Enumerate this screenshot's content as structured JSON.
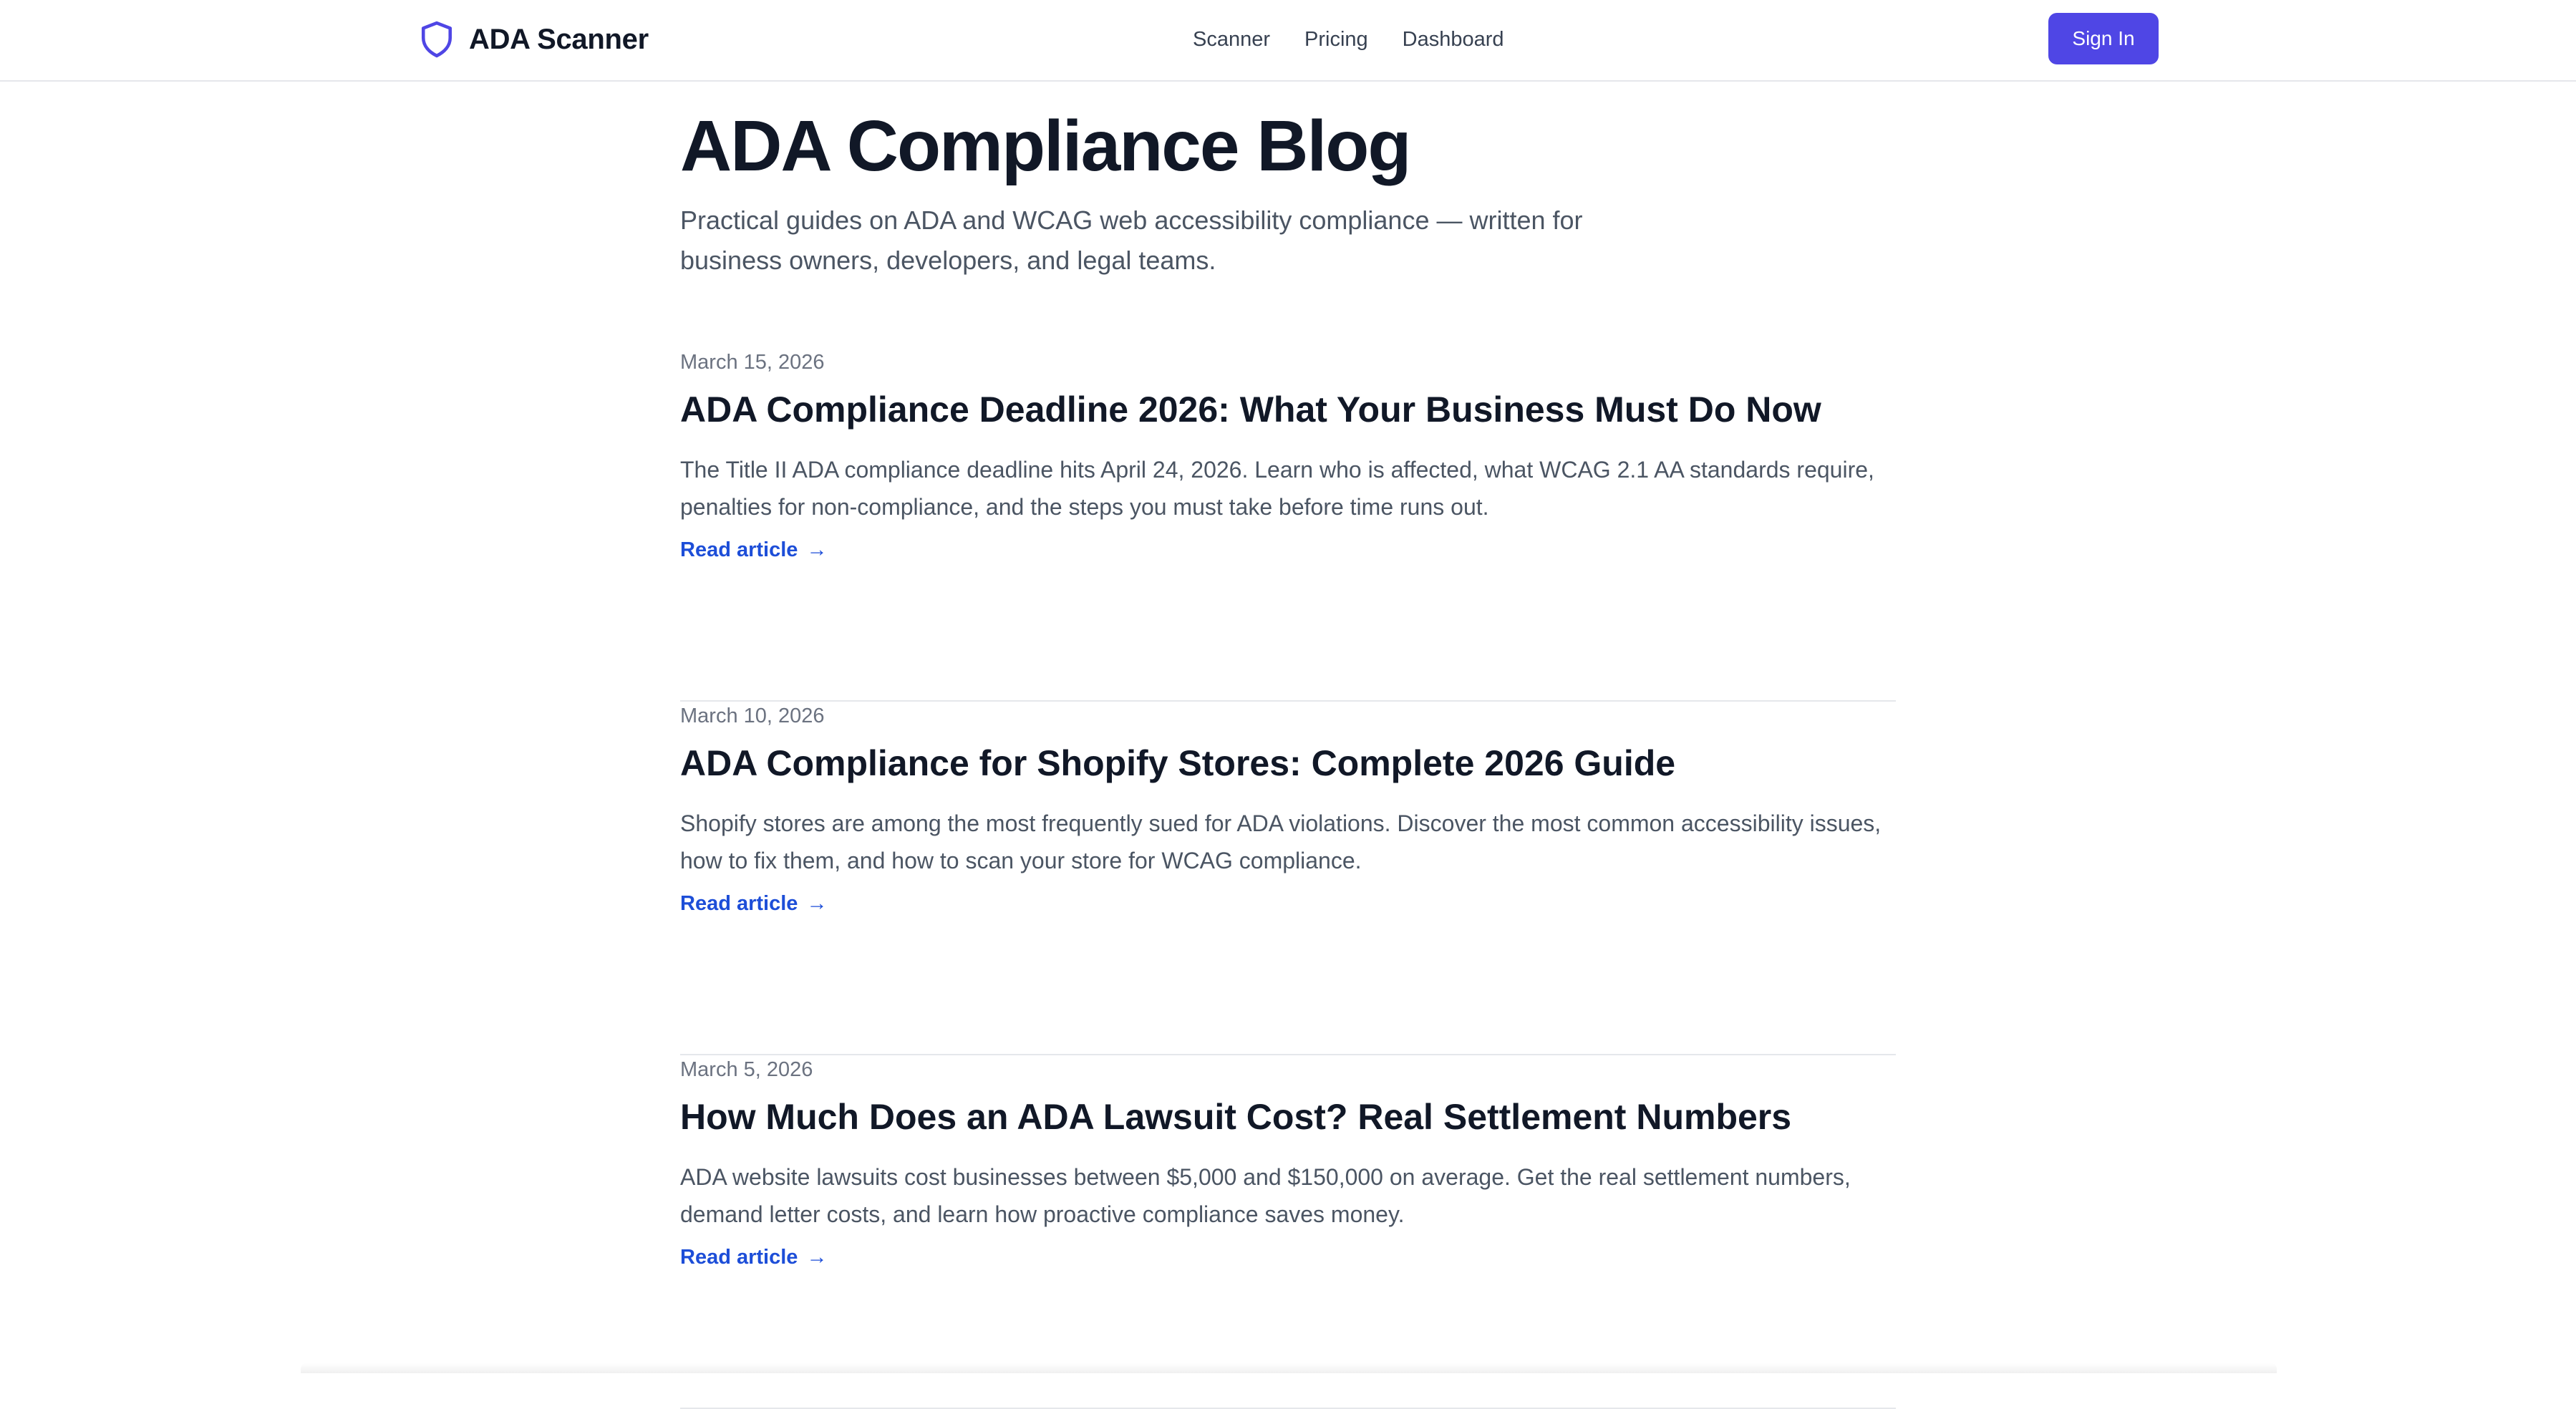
{
  "header": {
    "brand_name": "ADA Scanner",
    "brand_icon": "shield-icon",
    "nav_items": [
      {
        "label": "Scanner"
      },
      {
        "label": "Pricing"
      },
      {
        "label": "Dashboard"
      }
    ],
    "sign_in_label": "Sign In"
  },
  "colors": {
    "accent": "#4f46e5",
    "link": "#1d4ed8",
    "heading": "#111827",
    "body_text": "#4b5563",
    "muted": "#6b7280",
    "divider": "#e5e7eb"
  },
  "blog": {
    "title": "ADA Compliance Blog",
    "intro": "Practical guides on ADA and WCAG web accessibility compliance — written for business owners, developers, and legal teams.",
    "posts": [
      {
        "date": "March 15, 2026",
        "title": "ADA Compliance Deadline 2026: What Your Business Must Do Now",
        "excerpt": "The Title II ADA compliance deadline hits April 24, 2026. Learn who is affected, what WCAG 2.1 AA standards require, penalties for non-compliance, and the steps you must take before time runs out.",
        "link_label": "Read article",
        "link_arrow": "→"
      },
      {
        "date": "March 10, 2026",
        "title": "ADA Compliance for Shopify Stores: Complete 2026 Guide",
        "excerpt": "Shopify stores are among the most frequently sued for ADA violations. Discover the most common accessibility issues, how to fix them, and how to scan your store for WCAG compliance.",
        "link_label": "Read article",
        "link_arrow": "→"
      },
      {
        "date": "March 5, 2026",
        "title": "How Much Does an ADA Lawsuit Cost? Real Settlement Numbers",
        "excerpt": "ADA website lawsuits cost businesses between $5,000 and $150,000 on average. Get the real settlement numbers, demand letter costs, and learn how proactive compliance saves money.",
        "link_label": "Read article",
        "link_arrow": "→"
      }
    ]
  }
}
